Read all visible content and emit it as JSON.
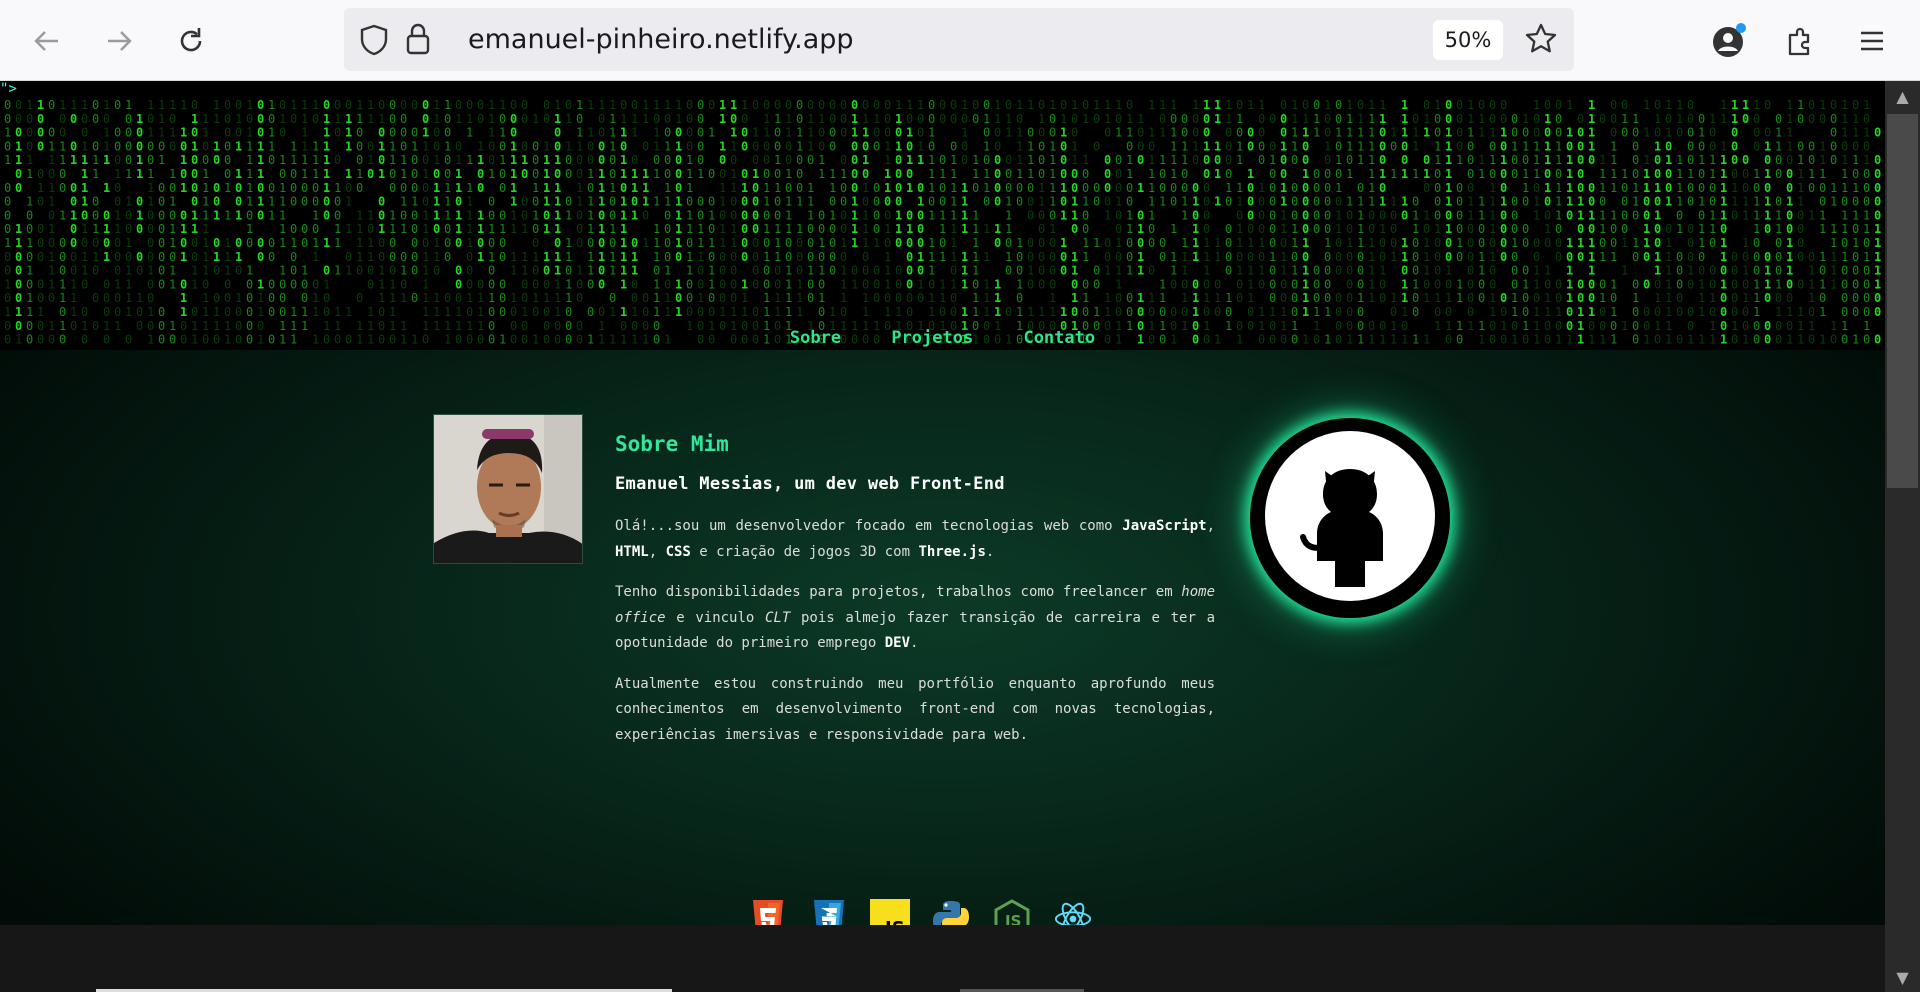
{
  "browser": {
    "url": "emanuel-pinheiro.netlify.app",
    "zoom": "50%",
    "icons": [
      "back-arrow-icon",
      "forward-arrow-icon",
      "reload-icon",
      "shield-icon",
      "lock-icon",
      "star-icon",
      "account-icon",
      "extensions-icon",
      "menu-icon"
    ]
  },
  "page": {
    "stray_text": "\">",
    "nav": [
      "Sobre",
      "Projetos",
      "Contato"
    ],
    "about": {
      "title": "Sobre Mim",
      "subtitle": "Emanuel Messias, um dev web Front-End",
      "p1": {
        "lead": "Olá!...sou um desenvolvedor focado em tecnologias web como ",
        "t1": "JavaScript",
        "s1": ", ",
        "t2": "HTML",
        "s2": ", ",
        "t3": "CSS",
        "s3": " e criação de jogos 3D com ",
        "t4": "Three.js",
        "s4": "."
      },
      "p2": {
        "lead": "Tenho disponibilidades para projetos, trabalhos como freelancer em ",
        "i1": "home office",
        "s1": " e vinculo ",
        "i2": "CLT",
        "s2": " pois almejo fazer transição de carreira e ter a opotunidade do primeiro emprego ",
        "b1": "DEV",
        "s3": "."
      },
      "p3": "Atualmente estou construindo meu portfólio enquanto aprofundo meus conhecimentos em desenvolvimento front-end com novas tecnologias, experiências imersivas e responsividade para web.",
      "tech_icons": [
        "html5-icon",
        "css3-icon",
        "javascript-icon",
        "python-icon",
        "nodejs-icon",
        "react-icon"
      ]
    }
  },
  "colors": {
    "accent": "#2ee58a",
    "matrix_green": "#1ec81e",
    "glow": "#23e59a"
  }
}
